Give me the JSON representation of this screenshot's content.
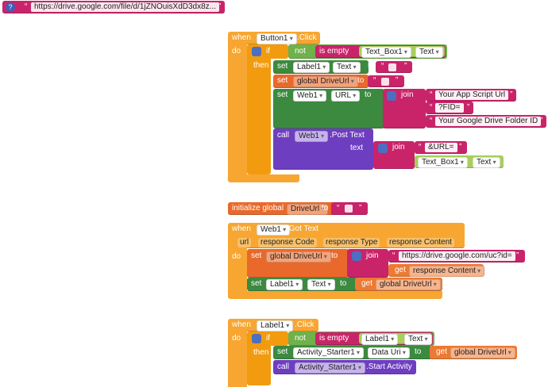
{
  "comment_block": {
    "help_icon": "?",
    "url": "https://drive.google.com/file/d/1jZNOuisXdD3dx8z..."
  },
  "block1": {
    "when": "when",
    "component": "Button1",
    "event": ".Click",
    "do": "do",
    "if": "if",
    "then": "then",
    "not": "not",
    "is_empty": "is empty",
    "textbox": "Text_Box1",
    "text_prop": "Text",
    "set1": {
      "set": "set",
      "component": "Label1",
      "prop": "Text",
      "to": "to"
    },
    "set2": {
      "set": "set",
      "var": "global DriveUrl",
      "to": "to"
    },
    "set3": {
      "set": "set",
      "component": "Web1",
      "prop": "URL",
      "to": "to",
      "join": "join",
      "items": [
        "Your App Script Url",
        "?FID=",
        "Your Google Drive Folder ID"
      ]
    },
    "call": {
      "call": "call",
      "component": "Web1",
      "method": ".Post Text",
      "text_label": "text",
      "join": "join",
      "item1": "&URL=",
      "textbox": "Text_Box1",
      "text_prop": "Text"
    }
  },
  "init": {
    "label": "initialize global",
    "name": "DriveUrl",
    "to": "to"
  },
  "block2": {
    "when": "when",
    "component": "Web1",
    "event": ".Got Text",
    "params": [
      "url",
      "response Code",
      "response Type",
      "response Content"
    ],
    "do": "do",
    "set1": {
      "set": "set",
      "var": "global DriveUrl",
      "to": "to",
      "join": "join",
      "item1": "https://drive.google.com/uc?id=",
      "get": "get",
      "get_var": "response Content"
    },
    "set2": {
      "set": "set",
      "component": "Label1",
      "prop": "Text",
      "to": "to",
      "get": "get",
      "get_var": "global DriveUrl"
    }
  },
  "block3": {
    "when": "when",
    "component": "Label1",
    "event": ".Click",
    "do": "do",
    "if": "if",
    "then": "then",
    "not": "not",
    "is_empty": "is empty",
    "label": "Label1",
    "text_prop": "Text",
    "set1": {
      "set": "set",
      "component": "Activity_Starter1",
      "prop": "Data Uri",
      "to": "to",
      "get": "get",
      "get_var": "global DriveUrl"
    },
    "call": {
      "call": "call",
      "component": "Activity_Starter1",
      "method": ".Start Activity"
    }
  }
}
